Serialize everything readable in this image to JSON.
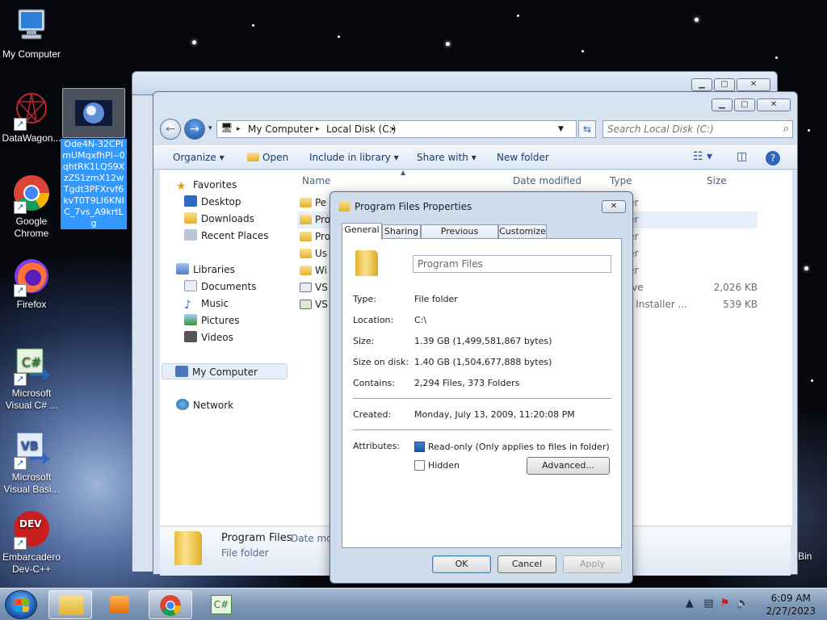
{
  "desktop": {
    "icons": [
      {
        "label": "My Computer"
      },
      {
        "label": "DataWagon..."
      },
      {
        "label": "Google Chrome"
      },
      {
        "label": "Firefox"
      },
      {
        "label": "Microsoft Visual C# ..."
      },
      {
        "label": "Microsoft Visual Basi..."
      },
      {
        "label": "Embarcadero Dev-C++"
      }
    ],
    "selected_file_label": "Ode4N-32CPImUMqxfhPI--0qhtRK1LQS9XzZS1zmX12wTgdt3PFXrvf6kvT0T9LI6KNIC_7vs_A9krtLg",
    "recycle_bin_partial": "Bin",
    "dev_icon_text": "DEV",
    "csharp_badge": "C#",
    "vb_badge": "VB"
  },
  "explorer": {
    "breadcrumb": [
      "My Computer",
      "Local Disk (C:)"
    ],
    "search_placeholder": "Search Local Disk (C:)",
    "toolbar": {
      "organize": "Organize",
      "open": "Open",
      "include_in_library": "Include in library",
      "share_with": "Share with",
      "new_folder": "New folder"
    },
    "nav": {
      "favorites": "Favorites",
      "desktop": "Desktop",
      "downloads": "Downloads",
      "recent_places": "Recent Places",
      "libraries": "Libraries",
      "documents": "Documents",
      "music": "Music",
      "pictures": "Pictures",
      "videos": "Videos",
      "my_computer": "My Computer",
      "network": "Network"
    },
    "columns": {
      "name": "Name",
      "date_modified": "Date modified",
      "type": "Type",
      "size": "Size"
    },
    "rows": [
      {
        "name": "Pe",
        "type": "older",
        "size": ""
      },
      {
        "name": "Pro",
        "type": "older",
        "size": ""
      },
      {
        "name": "Pro",
        "type": "older",
        "size": ""
      },
      {
        "name": "Us",
        "type": "older",
        "size": ""
      },
      {
        "name": "Wi",
        "type": "older",
        "size": ""
      },
      {
        "name": "VS",
        "type": "rchive",
        "size": "2,026 KB"
      },
      {
        "name": "VS",
        "type": "ows Installer ...",
        "size": "539 KB"
      }
    ],
    "details": {
      "name": "Program Files",
      "date_label": "Date mod",
      "type": "File folder"
    }
  },
  "properties": {
    "title": "Program Files Properties",
    "tabs": [
      "General",
      "Sharing",
      "Previous Versions",
      "Customize"
    ],
    "folder_name": "Program Files",
    "fields": {
      "type_label": "Type:",
      "type_value": "File folder",
      "location_label": "Location:",
      "location_value": "C:\\",
      "size_label": "Size:",
      "size_value": "1.39 GB (1,499,581,867 bytes)",
      "size_on_disk_label": "Size on disk:",
      "size_on_disk_value": "1.40 GB (1,504,677,888 bytes)",
      "contains_label": "Contains:",
      "contains_value": "2,294 Files, 373 Folders",
      "created_label": "Created:",
      "created_value": "Monday, July 13, 2009, 11:20:08 PM",
      "attributes_label": "Attributes:",
      "readonly_label": "Read-only (Only applies to files in folder)",
      "hidden_label": "Hidden"
    },
    "buttons": {
      "advanced": "Advanced...",
      "ok": "OK",
      "cancel": "Cancel",
      "apply": "Apply"
    }
  },
  "taskbar": {
    "time": "6:09 AM",
    "date": "2/27/2023",
    "csharp_badge": "C#"
  },
  "colors": {
    "accent": "#3399ff",
    "window_frame": "#d7e3f1",
    "taskbar": "#7f98b8"
  }
}
